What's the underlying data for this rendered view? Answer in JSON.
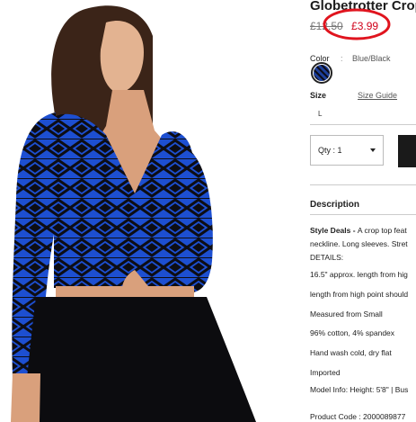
{
  "product": {
    "title": "Globetrotter Crop",
    "original_price": "£12.50",
    "sale_price": "£3.99"
  },
  "color": {
    "label": "Color",
    "separator": ":",
    "value": "Blue/Black"
  },
  "size": {
    "label": "Size",
    "guide_link": "Size Guide",
    "options": [
      "L"
    ]
  },
  "quantity": {
    "label": "Qty : 1"
  },
  "description": {
    "title": "Description",
    "lines": [
      {
        "bold": "Style Deals - ",
        "text": "A crop top feat"
      },
      {
        "bold": "",
        "text": "neckline. Long sleeves. Stret"
      },
      {
        "bold": "",
        "text": "DETAILS:"
      },
      {
        "bold": "",
        "text": "16.5\" approx. length from hig"
      },
      {
        "bold": "",
        "text": "length from high point should"
      },
      {
        "bold": "",
        "text": "Measured from Small"
      },
      {
        "bold": "",
        "text": "96% cotton, 4% spandex"
      },
      {
        "bold": "",
        "text": "Hand wash cold, dry flat"
      },
      {
        "bold": "",
        "text": "Imported"
      },
      {
        "bold": "",
        "text": "Model Info: Height: 5'8\" | Bus"
      },
      {
        "bold": "",
        "text": "Product Code : 2000089877"
      }
    ]
  },
  "colors": {
    "sale_red": "#d0021b",
    "annotation_circle": "#e0141e",
    "top_blue": "#1d4fd1",
    "top_black": "#0d0d14"
  }
}
